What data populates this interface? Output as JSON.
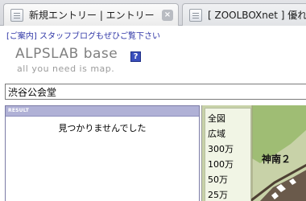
{
  "browser": {
    "tabs": [
      {
        "title": "新規エントリー | エントリー | ZOO"
      },
      {
        "title": "[ ZOOLBOXnet ] 優れたWeb"
      }
    ]
  },
  "notice": {
    "link": "[ご案内] スタッフブログもぜひご覧下さい"
  },
  "logo": {
    "title": "ALPSLAB base",
    "help_icon": "?",
    "tagline": "all you need is map."
  },
  "search": {
    "value": "渋谷公会堂"
  },
  "result": {
    "header": "RESULT",
    "message": "見つかりませんでした"
  },
  "map": {
    "scales": [
      "全図",
      "広域",
      "300万",
      "100万",
      "50万",
      "25万"
    ],
    "place_label": "神南２",
    "colors": {
      "park": "#9fbd74",
      "street": "#c8d2a8",
      "road": "#5b4b3c"
    }
  }
}
